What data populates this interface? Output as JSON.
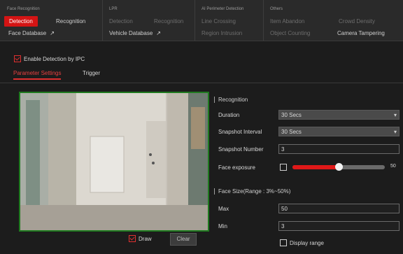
{
  "tabs": {
    "face_recognition": {
      "title": "Face Recognition",
      "detection": "Detection",
      "recognition": "Recognition",
      "face_database": "Face Database"
    },
    "lpr": {
      "title": "LPR",
      "item1": "Detection",
      "item2": "Recognition",
      "vehicle_database": "Vehicle Database"
    },
    "ai_perimeter": {
      "title": "AI Perimeter Detection",
      "line_crossing": "Line Crossing",
      "region": "Region Intrusion"
    },
    "others": {
      "title": "Others",
      "item1": "Item Abandon",
      "item2": "Object Counting",
      "item3": "Crowd Density",
      "camera_tampering": "Camera Tampering"
    }
  },
  "enable_detection": {
    "label": "Enable Detection by IPC",
    "checked": true
  },
  "subtabs": {
    "parameter": "Parameter Settings",
    "trigger": "Trigger"
  },
  "preview": {
    "draw_label": "Draw",
    "draw_checked": true,
    "clear_label": "Clear"
  },
  "recognition": {
    "section_title": "Recognition",
    "duration_label": "Duration",
    "duration_value": "30 Secs",
    "snapshot_interval_label": "Snapshot Interval",
    "snapshot_interval_value": "30 Secs",
    "snapshot_number_label": "Snapshot Number",
    "snapshot_number_value": "3",
    "face_exposure_label": "Face exposure",
    "face_exposure_enabled": false,
    "face_exposure_value": "50",
    "face_exposure_fraction": 0.5
  },
  "face_size": {
    "section_title": "Face Size(Range : 3%~50%)",
    "max_label": "Max",
    "max_value": "50",
    "min_label": "Min",
    "min_value": "3",
    "display_range_label": "Display range",
    "display_range_checked": false
  },
  "colors": {
    "accent": "#d41414",
    "frame": "#1f7a1f"
  },
  "icons": {
    "link": "arrow-up-right-icon",
    "dropdown": "chevron-down-icon"
  }
}
